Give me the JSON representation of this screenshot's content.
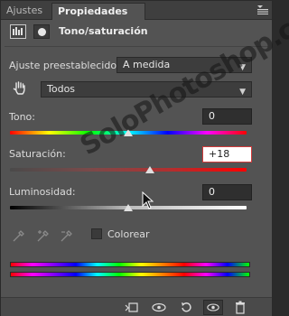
{
  "tabs": [
    {
      "label": "Ajustes",
      "active": false
    },
    {
      "label": "Propiedades",
      "active": true
    }
  ],
  "header": {
    "title": "Tono/saturación"
  },
  "preset": {
    "label": "Ajuste preestablecido:",
    "value": "A medida"
  },
  "channel": {
    "value": "Todos"
  },
  "hue": {
    "label": "Tono:",
    "value": "0",
    "level": 0
  },
  "saturation": {
    "label": "Saturación:",
    "value": "+18",
    "level": 18
  },
  "lightness": {
    "label": "Luminosidad:",
    "value": "0",
    "level": 0
  },
  "colorize": {
    "label": "Colorear",
    "checked": false
  },
  "watermark": "SoloPhotoshop.com",
  "colors": {
    "panel_bg": "#535353",
    "active_field_border": "#d23b3b"
  },
  "icons": {
    "tab_menu": "menu-icon",
    "adjustment": "adjustment-layer-icon",
    "mask": "mask-icon",
    "hand": "targeted-adjustment-hand-icon",
    "droppers": [
      "eyedropper-icon",
      "eyedropper-plus-icon",
      "eyedropper-minus-icon"
    ],
    "toolbar": [
      "clip-to-layer-icon",
      "view-previous-state-icon",
      "reset-icon",
      "visibility-eye-icon",
      "trash-icon"
    ]
  }
}
